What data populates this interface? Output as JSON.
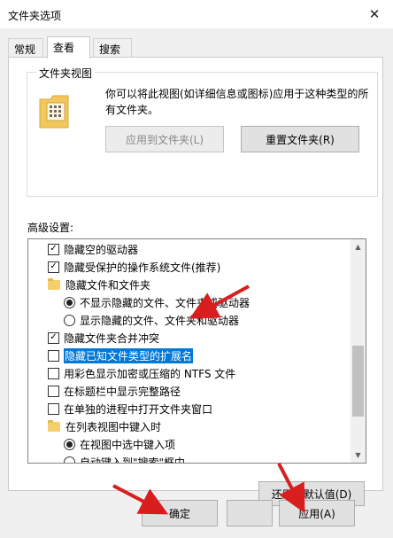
{
  "window": {
    "title": "文件夹选项",
    "close_symbol": "✕"
  },
  "tabs": [
    {
      "label": "常规",
      "active": false
    },
    {
      "label": "查看",
      "active": true
    },
    {
      "label": "搜索",
      "active": false
    }
  ],
  "folder_view": {
    "group_label": "文件夹视图",
    "description": "你可以将此视图(如详细信息或图标)应用于这种类型的所有文件夹。",
    "apply_button": "应用到文件夹(L)",
    "reset_button": "重置文件夹(R)"
  },
  "advanced": {
    "label": "高级设置:",
    "items": [
      {
        "type": "checkbox",
        "checked": true,
        "label": "隐藏空的驱动器"
      },
      {
        "type": "checkbox",
        "checked": true,
        "label": "隐藏受保护的操作系统文件(推荐)"
      },
      {
        "type": "folder",
        "label": "隐藏文件和文件夹"
      },
      {
        "type": "radio",
        "checked": true,
        "label": "不显示隐藏的文件、文件夹或驱动器"
      },
      {
        "type": "radio",
        "checked": false,
        "label": "显示隐藏的文件、文件夹和驱动器"
      },
      {
        "type": "checkbox",
        "checked": true,
        "label": "隐藏文件夹合并冲突"
      },
      {
        "type": "checkbox",
        "checked": false,
        "label": "隐藏已知文件类型的扩展名",
        "selected": true
      },
      {
        "type": "checkbox",
        "checked": false,
        "label": "用彩色显示加密或压缩的 NTFS 文件"
      },
      {
        "type": "checkbox",
        "checked": false,
        "label": "在标题栏中显示完整路径"
      },
      {
        "type": "checkbox",
        "checked": false,
        "label": "在单独的进程中打开文件夹窗口"
      },
      {
        "type": "folder",
        "label": "在列表视图中键入时"
      },
      {
        "type": "radio",
        "checked": true,
        "label": "在视图中选中键入项"
      },
      {
        "type": "radio",
        "checked": false,
        "label": "自动键入到\"搜索\"框中"
      }
    ],
    "restore_button": "还原为默认值(D)"
  },
  "footer": {
    "ok_button": "确定",
    "cancel_button": "",
    "apply_button": "应用(A)"
  },
  "colors": {
    "selection": "#0078d7",
    "annotation_arrow": "#d81e1e",
    "folder": "#f5cf6b"
  }
}
